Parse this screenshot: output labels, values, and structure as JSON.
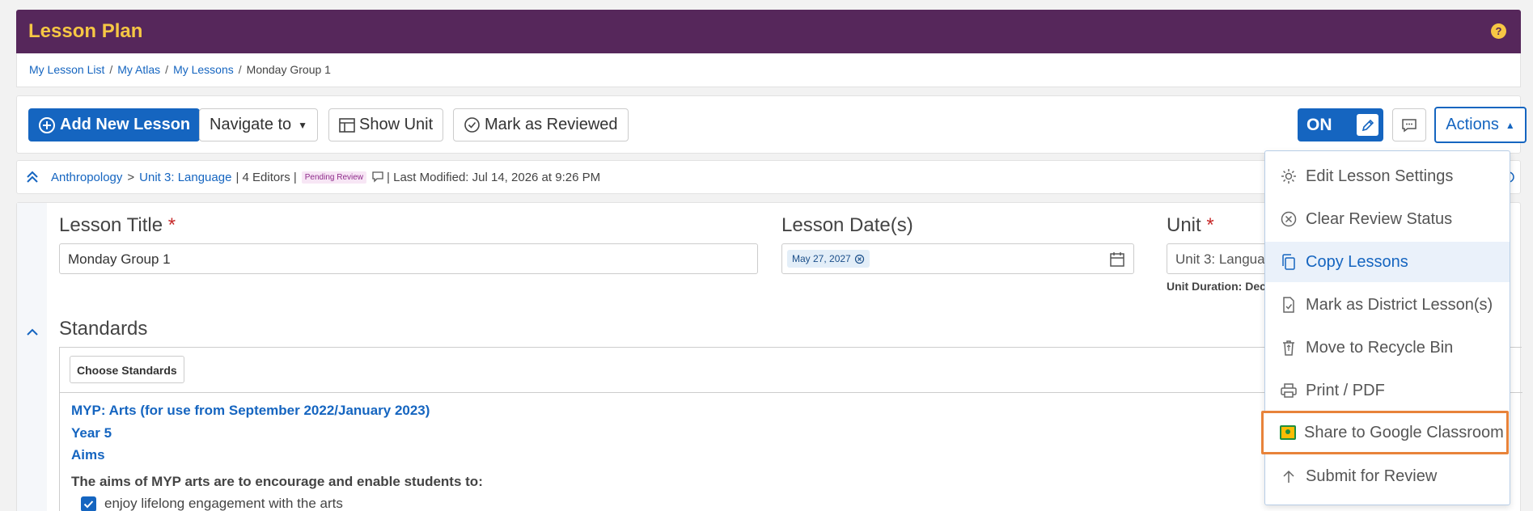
{
  "header": {
    "title": "Lesson Plan",
    "help": "?"
  },
  "breadcrumb": {
    "links": [
      "My Lesson List",
      "My Atlas",
      "My Lessons"
    ],
    "separator": "/",
    "current": "Monday Group 1"
  },
  "toolbar": {
    "add_new": "Add New Lesson",
    "navigate_to": "Navigate to",
    "show_unit": "Show Unit",
    "mark_reviewed": "Mark as Reviewed",
    "toggle": "ON",
    "actions": "Actions"
  },
  "meta": {
    "course": "Anthropology",
    "chevron": ">",
    "unit": "Unit 3: Language",
    "editors": "| 4 Editors |",
    "status": "Pending Review",
    "last_modified": "| Last Modified: Jul 14, 2026 at 9:26 PM"
  },
  "form": {
    "lesson_title_label": "Lesson Title",
    "lesson_title_value": "Monday Group 1",
    "lesson_dates_label": "Lesson Date(s)",
    "lesson_date_chip": "May 27, 2027",
    "unit_label": "Unit",
    "unit_value": "Unit 3: Langua",
    "unit_duration": "Unit Duration: Dec",
    "required_mark": "*"
  },
  "standards": {
    "label": "Standards",
    "choose_button": "Choose Standards",
    "framework": "MYP: Arts (for use from September 2022/January 2023)",
    "year": "Year 5",
    "section": "Aims",
    "description": "The aims of MYP arts are to encourage and enable students to:",
    "item": "enjoy lifelong engagement with the arts"
  },
  "actions_menu": {
    "items": [
      "Edit Lesson Settings",
      "Clear Review Status",
      "Copy Lessons",
      "Mark as District Lesson(s)",
      "Move to Recycle Bin",
      "Print / PDF",
      "Share to Google Classroom",
      "Submit for Review"
    ]
  },
  "colors": {
    "header_bg": "#56275b",
    "header_title": "#f6c744",
    "primary": "#1565c0",
    "highlight_border": "#e8833a"
  }
}
